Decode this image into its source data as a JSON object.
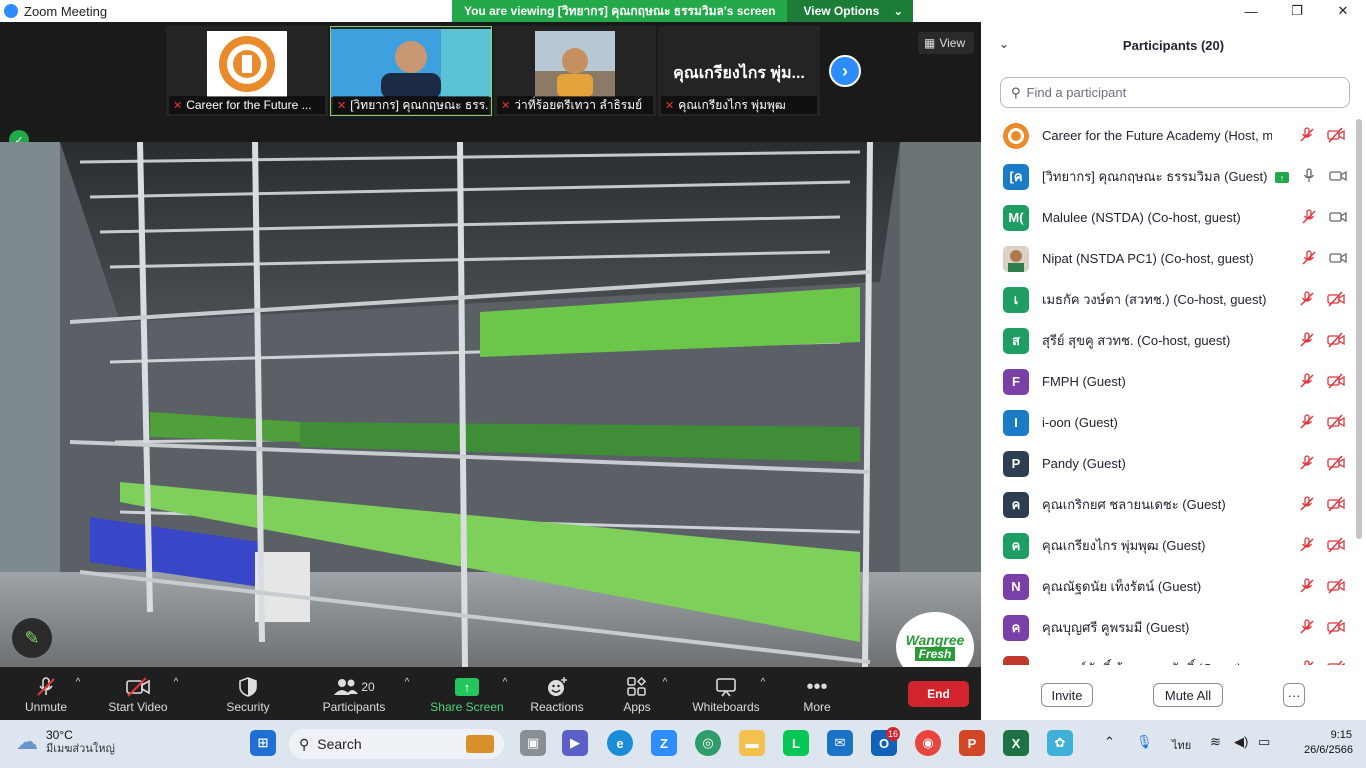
{
  "window": {
    "title": "Zoom Meeting",
    "minimize": "—",
    "restore": "❐",
    "close": "✕"
  },
  "banner": {
    "message": "You are viewing [วิทยากร] คุณกฤษณะ ธรรมวิมล's screen",
    "options_label": "View Options"
  },
  "thumbnails": [
    {
      "label": "Career for the Future ...",
      "muted": true
    },
    {
      "label": "[วิทยากร] คุณกฤษณะ ธรร...",
      "muted": true,
      "active": true
    },
    {
      "label": "ว่าที่ร้อยตรีเทวา ลำธิรมย์",
      "muted": true
    },
    {
      "label": "คุณเกรียงไกร พุ่มพุฒ",
      "big_name": "คุณเกรียงไกร พุ่ม...",
      "muted": true
    }
  ],
  "view_button": "View",
  "share_logo": {
    "line1": "Wangree",
    "line2": "Fresh"
  },
  "toolbar": {
    "unmute": "Unmute",
    "start_video": "Start Video",
    "security": "Security",
    "participants": "Participants",
    "participants_count": "20",
    "share_screen": "Share Screen",
    "reactions": "Reactions",
    "apps": "Apps",
    "whiteboards": "Whiteboards",
    "more": "More",
    "end": "End"
  },
  "panel": {
    "title": "Participants (20)",
    "search_placeholder": "Find a participant",
    "participants": [
      {
        "initials": "",
        "name": "Career for the Future Academy (Host, me)",
        "color": "#e98a2b",
        "mic": "off",
        "cam": "off"
      },
      {
        "initials": "[ค",
        "name": "[วิทยากร] คุณกฤษณะ ธรรมวิมล (Guest)",
        "color": "#1b7bc6",
        "mic": "on",
        "cam": "on",
        "sharing": true
      },
      {
        "initials": "M(",
        "name": "Malulee (NSTDA) (Co-host, guest)",
        "color": "#1f9e63",
        "mic": "off",
        "cam": "on"
      },
      {
        "initials": "",
        "name": "Nipat (NSTDA PC1) (Co-host, guest)",
        "color": "#c9b79a",
        "mic": "off",
        "cam": "on"
      },
      {
        "initials": "เ",
        "name": "เมธกัค วงษ์ตา (สวทช.) (Co-host, guest)",
        "color": "#1f9e63",
        "mic": "off",
        "cam": "off"
      },
      {
        "initials": "ส",
        "name": "สุรีย์ สุขคู สวทช. (Co-host, guest)",
        "color": "#1f9e63",
        "mic": "off",
        "cam": "off"
      },
      {
        "initials": "F",
        "name": "FMPH (Guest)",
        "color": "#7b3fa8",
        "mic": "off",
        "cam": "off"
      },
      {
        "initials": "I",
        "name": "i-oon (Guest)",
        "color": "#1b7bc6",
        "mic": "off",
        "cam": "off"
      },
      {
        "initials": "P",
        "name": "Pandy (Guest)",
        "color": "#2d3e50",
        "mic": "off",
        "cam": "off"
      },
      {
        "initials": "ค",
        "name": "คุณเกริกยศ ชลายนเดชะ (Guest)",
        "color": "#2d3e50",
        "mic": "off",
        "cam": "off"
      },
      {
        "initials": "ค",
        "name": "คุณเกรียงไกร พุ่มพุฒ (Guest)",
        "color": "#1f9e63",
        "mic": "off",
        "cam": "off"
      },
      {
        "initials": "N",
        "name": "คุณณัฐดนัย เท็งรัตน์ (Guest)",
        "color": "#7b3fa8",
        "mic": "off",
        "cam": "off"
      },
      {
        "initials": "ค",
        "name": "คุณบุญศรี คูพรมมี (Guest)",
        "color": "#7b3fa8",
        "mic": "off",
        "cam": "off"
      },
      {
        "initials": "ค",
        "name": "คุณพงษ์ศักดิ์ ต้นตระกูลศักดิ์ (Guest)",
        "color": "#c0392b",
        "mic": "off",
        "cam": "off"
      }
    ],
    "invite": "Invite",
    "mute_all": "Mute All",
    "more": "···"
  },
  "taskbar": {
    "temp": "30°C",
    "weather_desc": "มีเมฆส่วนใหญ่",
    "search": "Search",
    "lang": "ไทย",
    "time": "9:15",
    "date": "26/6/2566",
    "outlook_badge": "16"
  }
}
